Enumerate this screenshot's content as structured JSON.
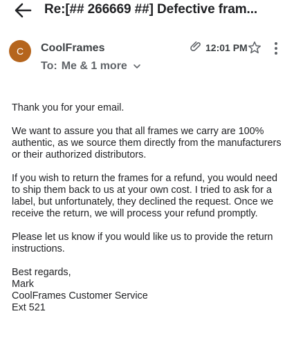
{
  "header": {
    "subject": "Re:[## 266669 ##] Defective fram..."
  },
  "message": {
    "avatar_letter": "C",
    "avatar_color": "#b5651d",
    "sender": "CoolFrames",
    "to_label": "To:",
    "to_value": "Me & 1 more",
    "time": "12:01 PM",
    "has_attachment": true
  },
  "body": {
    "p1": "Thank you for your email.",
    "p2": "We want to assure you that all frames we carry are 100% authentic, as we source them directly from the manufacturers or their authorized distributors.",
    "p3": "If you wish to return the frames for a refund, you would need to ship them back to us at your own cost. I tried to ask for a label, but unfortunately, they declined the request. Once we receive the return, we will process your refund promptly.",
    "p4": "Please let us know if you would like us to provide the return instructions.",
    "closing": "Best regards,",
    "name": "Mark",
    "team": "CoolFrames Customer Service",
    "ext": "Ext 521"
  },
  "icons": {
    "back": "back-arrow-icon",
    "attachment": "paperclip-icon",
    "star": "star-icon",
    "more": "more-vert-icon",
    "expand": "chevron-down-icon"
  }
}
